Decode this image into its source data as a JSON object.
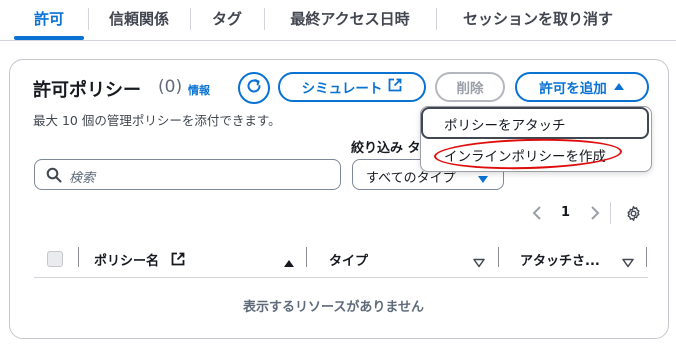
{
  "tabs": [
    {
      "label": "許可",
      "active": true
    },
    {
      "label": "信頼関係",
      "active": false
    },
    {
      "label": "タグ",
      "active": false
    },
    {
      "label": "最終アクセス日時",
      "active": false
    },
    {
      "label": "セッションを取り消す",
      "active": false
    }
  ],
  "panel": {
    "title": "許可ポリシー",
    "count": "(0)",
    "info_label": "情報",
    "description": "最大 10 個の管理ポリシーを添付できます。",
    "refresh_icon": "refresh-icon",
    "simulate_label": "シミュレート",
    "delete_label": "削除",
    "add_permissions_label": "許可を追加",
    "filter_label": "絞り込み タ",
    "search_placeholder": "検索",
    "type_select_value": "すべてのタイプ",
    "page_number": "1"
  },
  "table": {
    "columns": [
      {
        "label": "ポリシー名"
      },
      {
        "label": "タイプ"
      },
      {
        "label": "アタッチさ..."
      }
    ],
    "empty_message": "表示するリソースがありません"
  },
  "dropdown": {
    "items": [
      {
        "label": "ポリシーをアタッチ"
      },
      {
        "label": "インラインポリシーを作成"
      }
    ]
  },
  "colors": {
    "accent": "#0972d3",
    "annotation": "#e00c0c"
  }
}
